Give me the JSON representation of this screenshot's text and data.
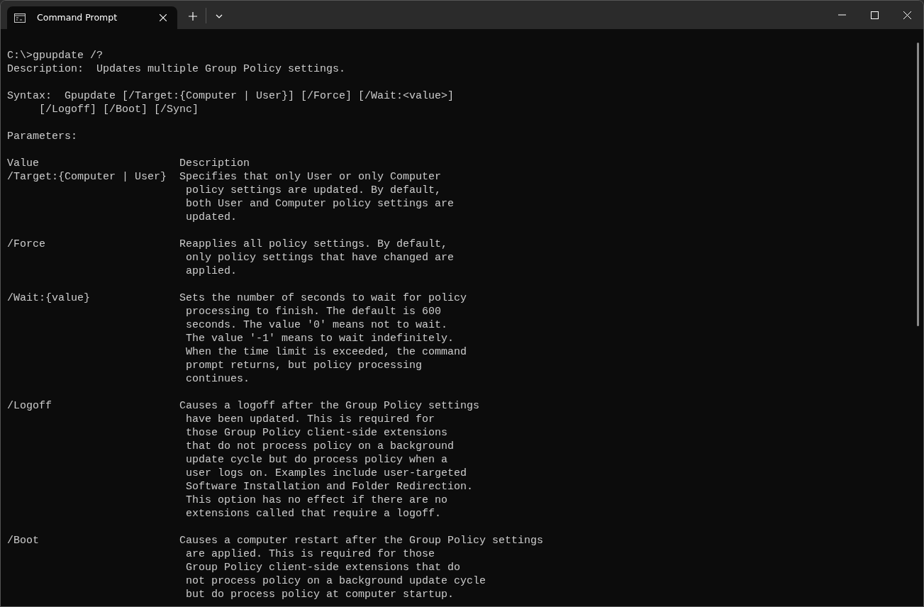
{
  "window": {
    "tabs": [
      {
        "title": "Command Prompt",
        "selected": true
      }
    ]
  },
  "terminal": {
    "blocks": [
      [
        "C:\\>gpupdate /?",
        "Description:  Updates multiple Group Policy settings."
      ],
      [
        "Syntax:  Gpupdate [/Target:{Computer | User}] [/Force] [/Wait:<value>]",
        "     [/Logoff] [/Boot] [/Sync]"
      ],
      [
        "Parameters:"
      ]
    ],
    "parameters": {
      "header": {
        "value": "Value",
        "description": "Description"
      },
      "rows": [
        {
          "value": "/Target:{Computer | User}",
          "description": [
            "Specifies that only User or only Computer",
            " policy settings are updated. By default,",
            " both User and Computer policy settings are",
            " updated."
          ]
        },
        {
          "value": "/Force",
          "description": [
            "Reapplies all policy settings. By default,",
            " only policy settings that have changed are",
            " applied."
          ]
        },
        {
          "value": "/Wait:{value}",
          "description": [
            "Sets the number of seconds to wait for policy",
            " processing to finish. The default is 600",
            " seconds. The value '0' means not to wait.",
            " The value '-1' means to wait indefinitely.",
            " When the time limit is exceeded, the command",
            " prompt returns, but policy processing",
            " continues."
          ]
        },
        {
          "value": "/Logoff",
          "description": [
            "Causes a logoff after the Group Policy settings",
            " have been updated. This is required for",
            " those Group Policy client-side extensions",
            " that do not process policy on a background",
            " update cycle but do process policy when a",
            " user logs on. Examples include user-targeted",
            " Software Installation and Folder Redirection.",
            " This option has no effect if there are no",
            " extensions called that require a logoff."
          ]
        },
        {
          "value": "/Boot",
          "description": [
            "Causes a computer restart after the Group Policy settings",
            " are applied. This is required for those",
            " Group Policy client-side extensions that do",
            " not process policy on a background update cycle",
            " but do process policy at computer startup."
          ]
        }
      ]
    }
  }
}
